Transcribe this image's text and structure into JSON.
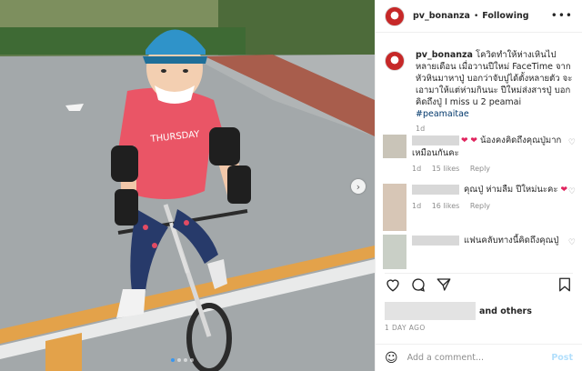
{
  "post": {
    "username": "pv_bonanza",
    "separator": "•",
    "follow_status": "Following",
    "more_icon": "more-dots-icon"
  },
  "caption": {
    "username": "pv_bonanza",
    "text": "โควิดทำให้ห่างเหินไปหลายเดือน เมื่อวานปีใหม่ FaceTime จากหัวหินมาหาปู่ บอกว่าจับปูได้ตั้งหลายตัว จะเอามาให้แต่ห่ามกินนะ ปีใหม่ส่งสารปู่ บอกคิดถึงปู่ I miss u 2 peamai",
    "hashtag": "#peamaitae",
    "time": "1d"
  },
  "comments": [
    {
      "text": "น้องคงคิดถึงคุณปู่มากเหมือนกันคะ",
      "time": "1d",
      "likes": "15 likes",
      "reply": "Reply",
      "avatar_color": "#c9c4b8",
      "hearts": "❤ ❤"
    },
    {
      "text": "คุณปู่ ห่ามลืม ปีใหม่นะคะ",
      "time": "1d",
      "likes": "16 likes",
      "reply": "Reply",
      "avatar_color": "#d7c6b6",
      "hearts": "❤"
    },
    {
      "text": "แฟนคลับทางนี้คิดถึงคุณปู่",
      "avatar_color": "#c9cfc6"
    }
  ],
  "stats": {
    "likes_suffix": "and others",
    "time": "1 DAY AGO"
  },
  "add_comment": {
    "placeholder": "Add a comment...",
    "post_label": "Post"
  },
  "colors": {
    "accent": "#3897f0",
    "heart": "#e0245e",
    "helmet": "#2f93c9",
    "shirt": "#ea5566"
  }
}
